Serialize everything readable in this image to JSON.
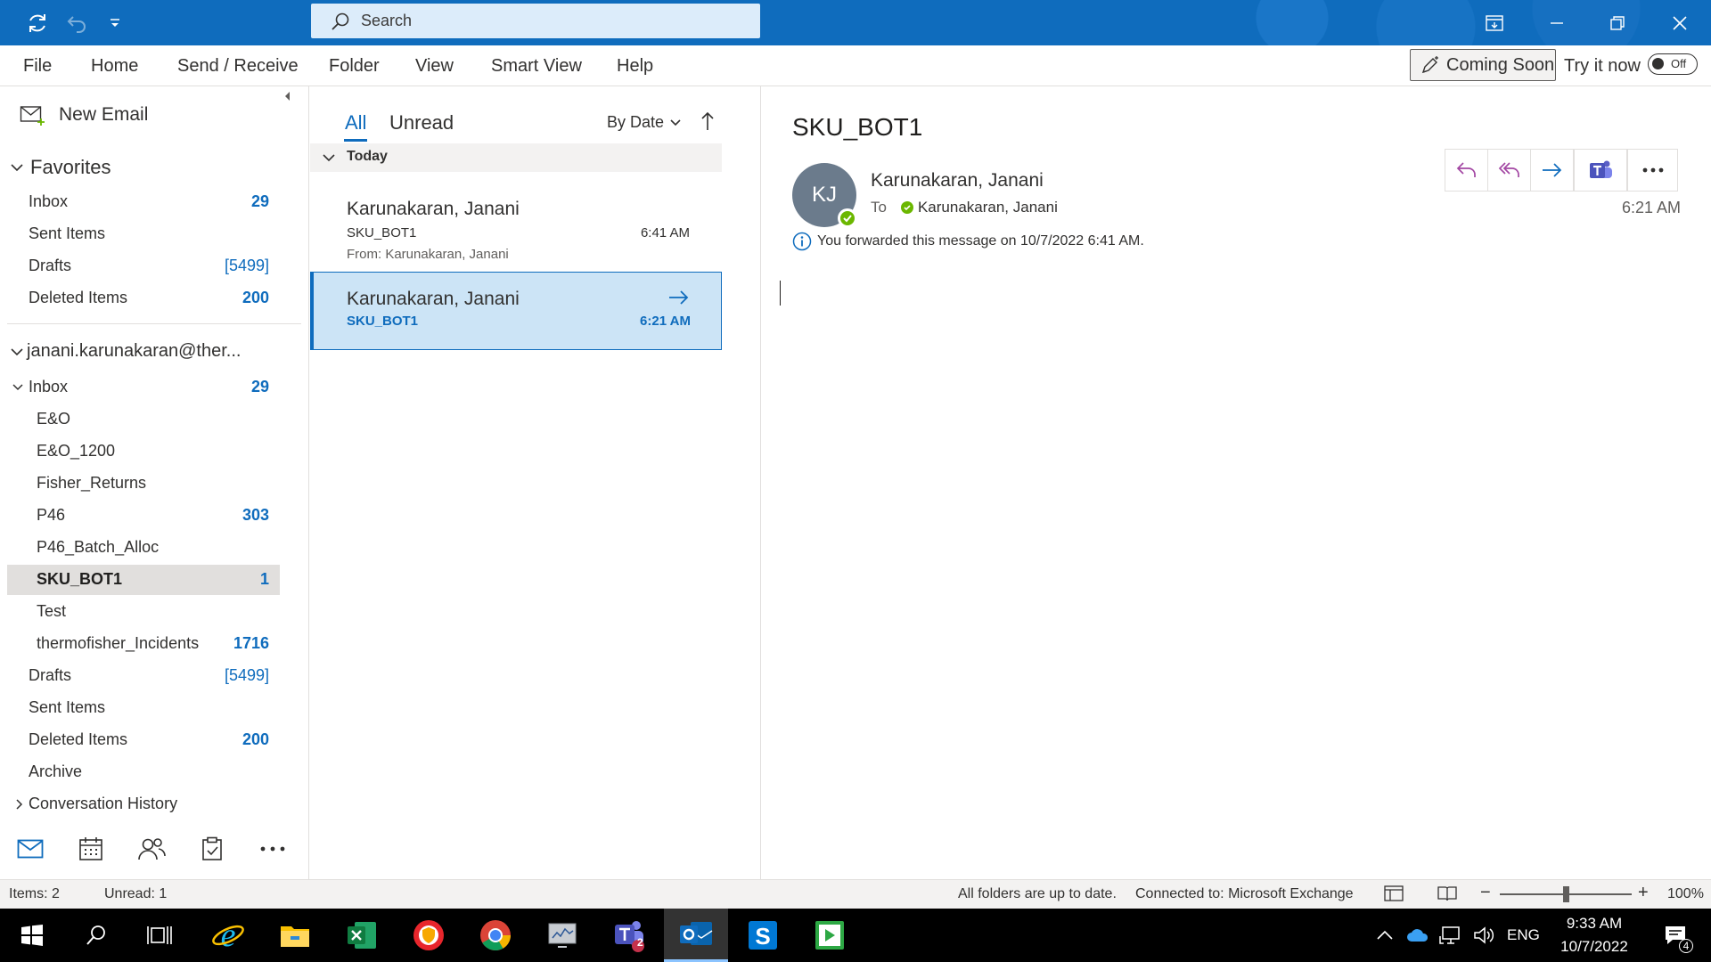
{
  "titlebar": {
    "search_placeholder": "Search"
  },
  "menu": {
    "items": [
      "File",
      "Home",
      "Send / Receive",
      "Folder",
      "View",
      "Smart View",
      "Help"
    ],
    "coming_soon": "Coming Soon",
    "try_it_now": "Try it now",
    "toggle_state": "Off"
  },
  "folder_pane": {
    "new_email": "New Email",
    "favorites_header": "Favorites",
    "favorites": [
      {
        "name": "Inbox",
        "count": "29"
      },
      {
        "name": "Sent Items",
        "count": ""
      },
      {
        "name": "Drafts",
        "count": "[5499]"
      },
      {
        "name": "Deleted Items",
        "count": "200"
      }
    ],
    "account": "janani.karunakaran@ther...",
    "inbox": {
      "name": "Inbox",
      "count": "29"
    },
    "subfolders": [
      {
        "name": "E&O",
        "count": ""
      },
      {
        "name": "E&O_1200",
        "count": ""
      },
      {
        "name": "Fisher_Returns",
        "count": ""
      },
      {
        "name": "P46",
        "count": "303"
      },
      {
        "name": "P46_Batch_Alloc",
        "count": ""
      },
      {
        "name": "SKU_BOT1",
        "count": "1"
      },
      {
        "name": "Test",
        "count": ""
      },
      {
        "name": "thermofisher_Incidents",
        "count": "1716"
      }
    ],
    "other_folders": [
      {
        "name": "Drafts",
        "count": "[5499]"
      },
      {
        "name": "Sent Items",
        "count": ""
      },
      {
        "name": "Deleted Items",
        "count": "200"
      },
      {
        "name": "Archive",
        "count": ""
      },
      {
        "name": "Conversation History",
        "count": ""
      }
    ]
  },
  "message_list": {
    "tab_all": "All",
    "tab_unread": "Unread",
    "sort": "By Date",
    "group": "Today",
    "messages": [
      {
        "from": "Karunakaran, Janani",
        "subject": "SKU_BOT1",
        "time": "6:41 AM",
        "preview": "From: Karunakaran, Janani"
      },
      {
        "from": "Karunakaran, Janani",
        "subject": "SKU_BOT1",
        "time": "6:21 AM",
        "preview": ""
      }
    ]
  },
  "reading_pane": {
    "subject": "SKU_BOT1",
    "initials": "KJ",
    "sender": "Karunakaran, Janani",
    "to_label": "To",
    "recipient": "Karunakaran, Janani",
    "time": "6:21 AM",
    "info": "You forwarded this message on 10/7/2022 6:41 AM."
  },
  "statusbar": {
    "items": "Items: 2",
    "unread": "Unread: 1",
    "sync": "All folders are up to date.",
    "connection": "Connected to: Microsoft Exchange",
    "zoom": "100%",
    "zoom_fraction": 0.5
  },
  "taskbar": {
    "language": "ENG",
    "clock_time": "9:33 AM",
    "clock_date": "10/7/2022",
    "teams_badge": "2",
    "notif_badge": "4"
  },
  "colors": {
    "accent": "#0f6cbd",
    "selected_msg": "#cce4f6",
    "presence_available": "#6bb700",
    "reply_icon": "#a347a3"
  }
}
